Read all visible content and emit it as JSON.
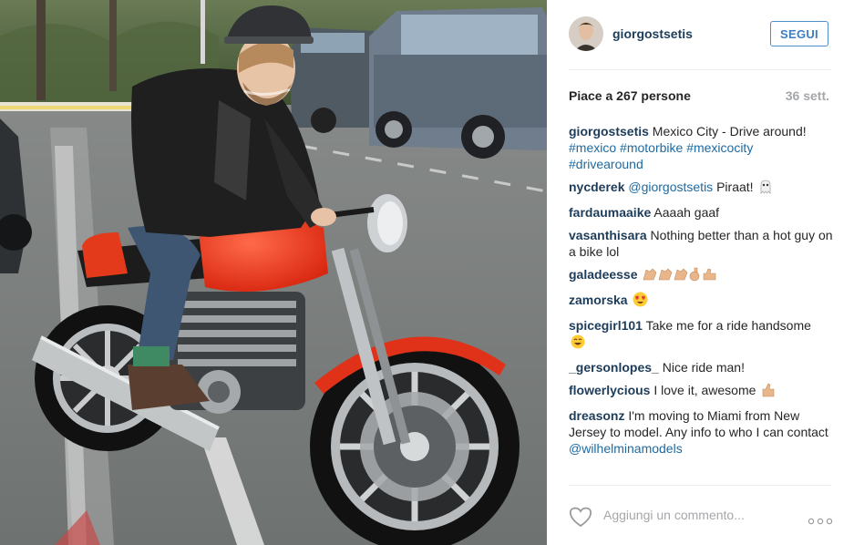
{
  "post": {
    "username": "giorgostsetis",
    "follow_label": "SEGUI",
    "likes_text": "Piace a 267 persone",
    "time_text": "36 sett."
  },
  "caption": {
    "user": "giorgostsetis",
    "text": "Mexico City - Drive around!",
    "tags": [
      "#mexico",
      "#motorbike",
      "#mexicocity",
      "#drivearound"
    ]
  },
  "comments": [
    {
      "user": "nycderek",
      "mention": "@giorgostsetis",
      "text": "Piraat!",
      "emoji": "ghost"
    },
    {
      "user": "fardaumaaike",
      "text": "Aaaah gaaf"
    },
    {
      "user": "vasanthisara",
      "text": "Nothing better than a hot guy on a bike lol"
    },
    {
      "user": "galadeesse",
      "text": "",
      "emoji": "clap-clap-clap-ok-thumbsup"
    },
    {
      "user": "zamorska",
      "text": "",
      "emoji": "heart-eyes"
    },
    {
      "user": "spicegirl101",
      "text": "Take me for a ride handsome",
      "emoji": "smile"
    },
    {
      "user": "_gersonlopes_",
      "text": "Nice ride man!"
    },
    {
      "user": "flowerlycious",
      "text": "I love it, awesome",
      "emoji": "thumbsup"
    },
    {
      "user": "dreasonz",
      "text": "I'm moving to Miami from New Jersey to model. Any info to who I can contact",
      "mention": "@wilhelminamodels"
    }
  ],
  "footer": {
    "add_comment_placeholder": "Aggiungi un commento...",
    "like_icon": "heart-outline-icon",
    "more_icon": "more-options-icon"
  },
  "colors": {
    "username": "#1d3c5a",
    "link": "#1d6aa1",
    "button": "#3d7fc2",
    "muted": "#a5a7aa"
  }
}
